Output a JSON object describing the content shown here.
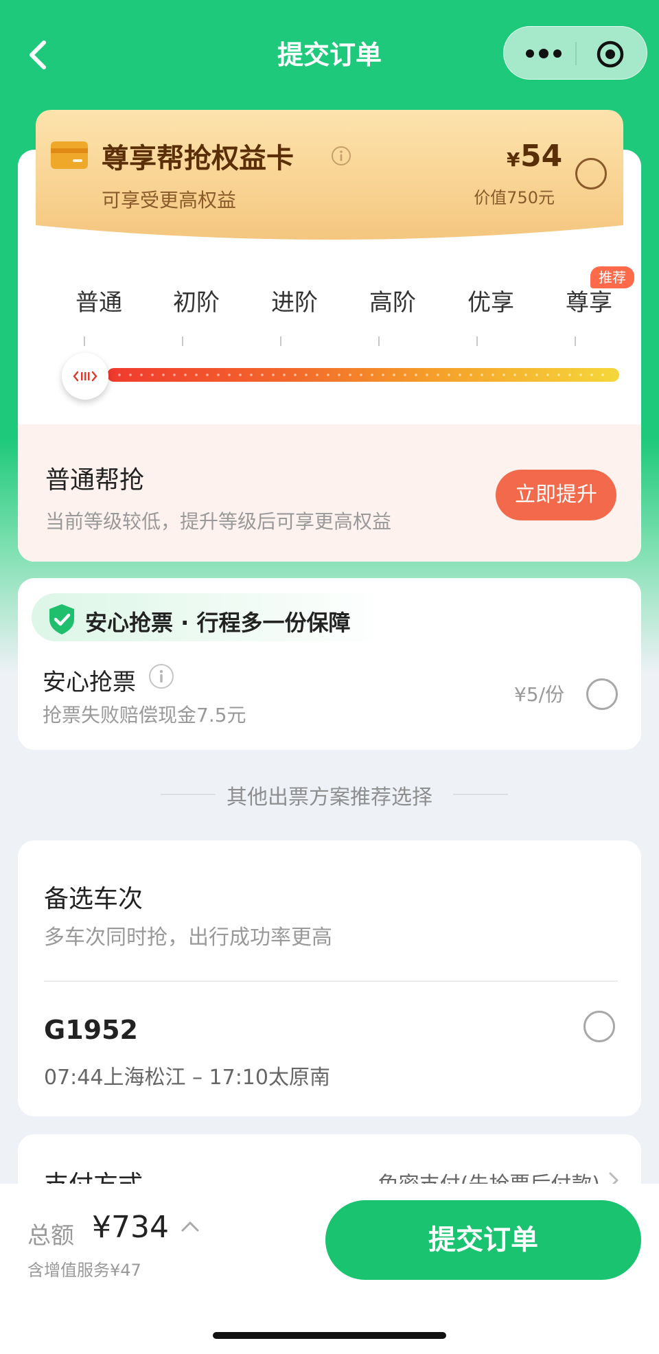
{
  "navbar": {
    "title": "提交订单"
  },
  "member_card": {
    "title": "尊享帮抢权益卡",
    "subtitle": "可享受更高权益",
    "price_symbol": "¥",
    "price": "54",
    "worth": "价值750元"
  },
  "levels": {
    "items": [
      "普通",
      "初阶",
      "进阶",
      "高阶",
      "优享",
      "尊享"
    ],
    "badge": "推荐",
    "selected_index": 0,
    "current_name": "普通帮抢",
    "current_desc": "当前等级较低，提升等级后可享更高权益",
    "upgrade_label": "立即提升"
  },
  "protection": {
    "header": "安心抢票 · 行程多一份保障",
    "name": "安心抢票",
    "desc": "抢票失败赔偿现金7.5元",
    "price": "¥5/份"
  },
  "divider": {
    "text": "其他出票方案推荐选择"
  },
  "alternates": {
    "title": "备选车次",
    "desc": "多车次同时抢，出行成功率更高",
    "train": {
      "number": "G1952",
      "route": "07:44上海松江 – 17:10太原南"
    }
  },
  "payment": {
    "label": "支付方式",
    "value": "免密支付(先抢票后付款)"
  },
  "footer": {
    "total_label": "总额",
    "total_amount": "¥734",
    "total_note": "含增值服务¥47",
    "submit_label": "提交订单"
  },
  "colors": {
    "brand_green": "#19c36f",
    "accent_orange": "#f26a4b",
    "gold": "#f8d291"
  }
}
